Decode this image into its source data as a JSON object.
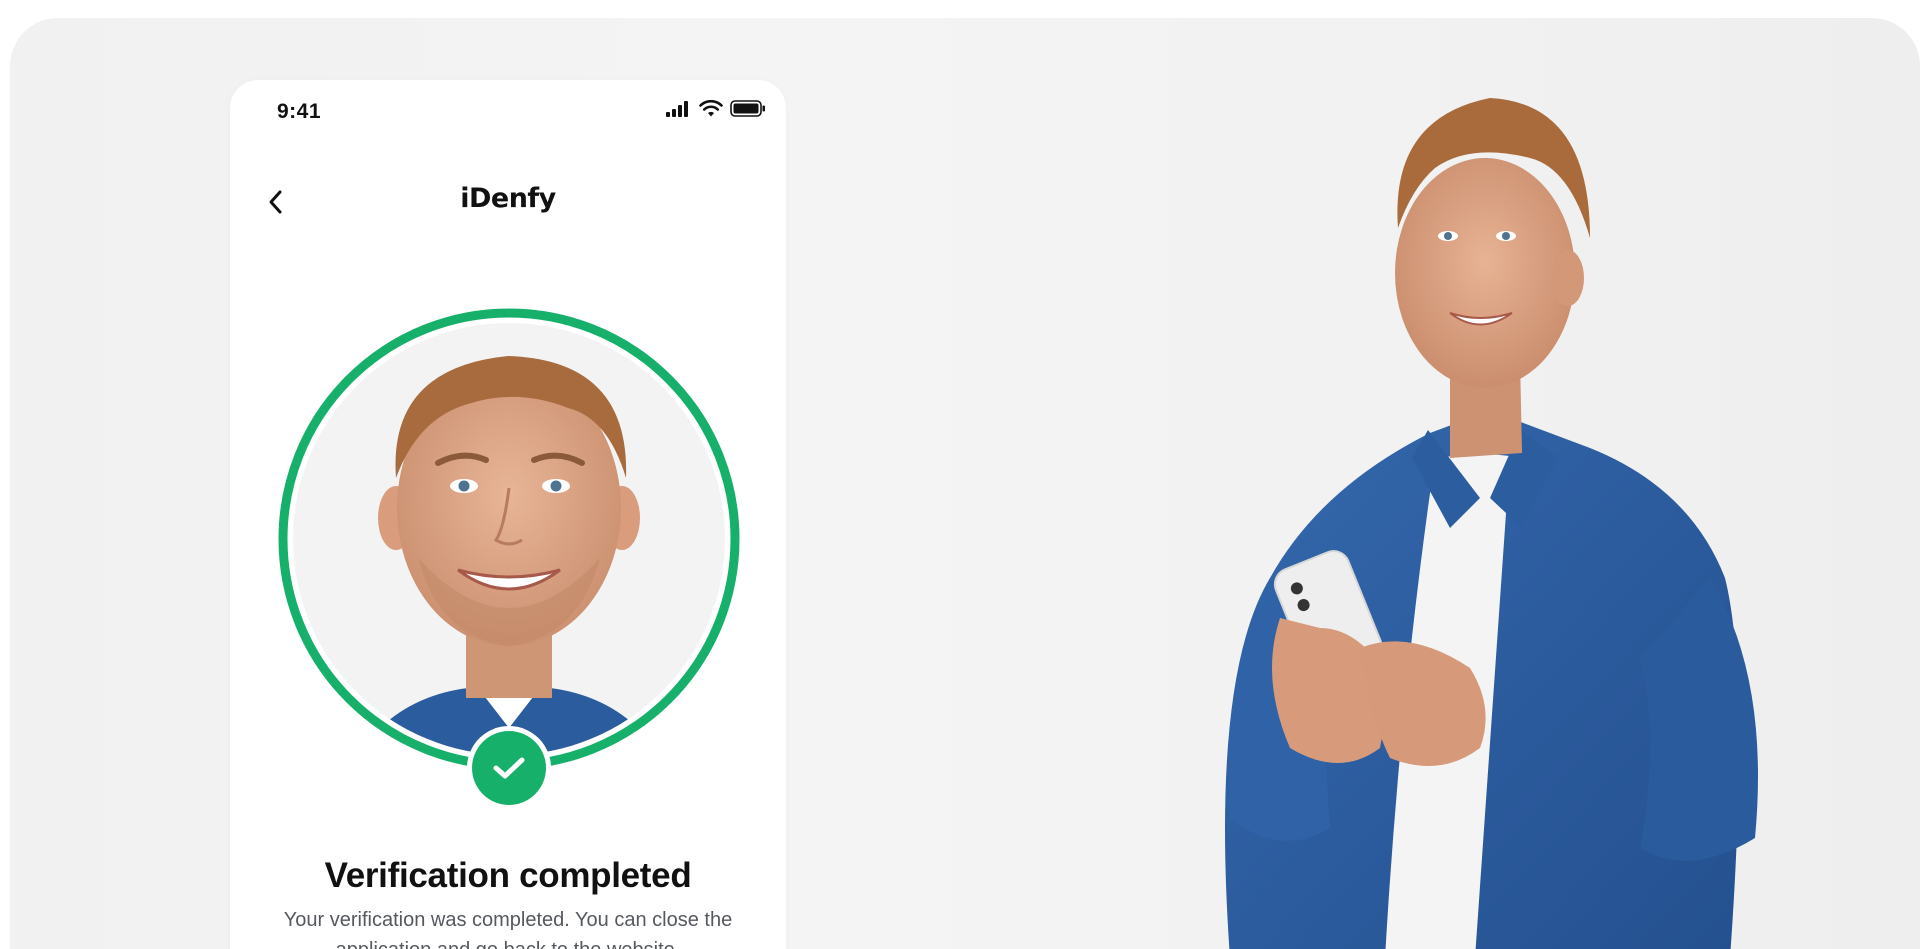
{
  "status_bar": {
    "time": "9:41",
    "icons": [
      "cellular-signal-icon",
      "wifi-icon",
      "battery-icon"
    ]
  },
  "nav": {
    "back_icon": "chevron-left-icon",
    "brand": "iDenfy"
  },
  "verification": {
    "status_icon": "checkmark-icon",
    "title": "Verification completed",
    "message": "Your verification was completed. You can close the application and go back to the website."
  },
  "colors": {
    "accent_green": "#16b06a",
    "background": "#f2f2f2",
    "card": "#ffffff",
    "title_text": "#111111",
    "body_text": "#55595f",
    "shirt_blue": "#2b5c9e"
  }
}
